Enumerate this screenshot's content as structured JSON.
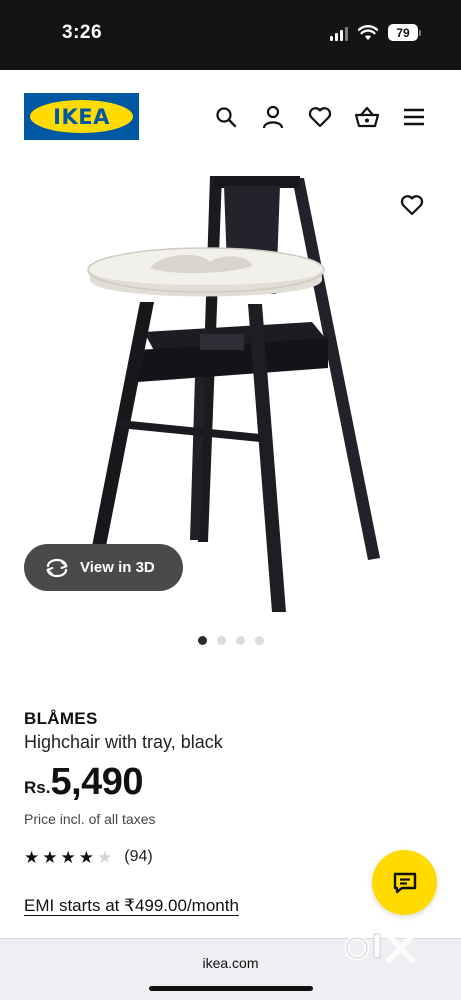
{
  "status_bar": {
    "time": "3:26",
    "battery": "79"
  },
  "header": {
    "logo_text": "IKEA",
    "icons": [
      "search-icon",
      "account-icon",
      "favourites-icon",
      "basket-icon",
      "menu-icon"
    ]
  },
  "gallery": {
    "view_3d_label": "View in 3D",
    "image_count": 4,
    "active_index": 0
  },
  "product": {
    "name": "BLÅMES",
    "description": "Highchair with tray, black",
    "currency": "Rs.",
    "price": "5,490",
    "price_note": "Price incl. of all taxes",
    "rating": 4,
    "rating_max": 5,
    "review_count": "(94)",
    "emi_text": "EMI starts at ₹499.00/month"
  },
  "browser": {
    "url": "ikea.com"
  },
  "watermark": {
    "text": "olx"
  },
  "colors": {
    "ikea_blue": "#0058a3",
    "ikea_yellow": "#ffdb00",
    "status_bar": "#141414"
  }
}
